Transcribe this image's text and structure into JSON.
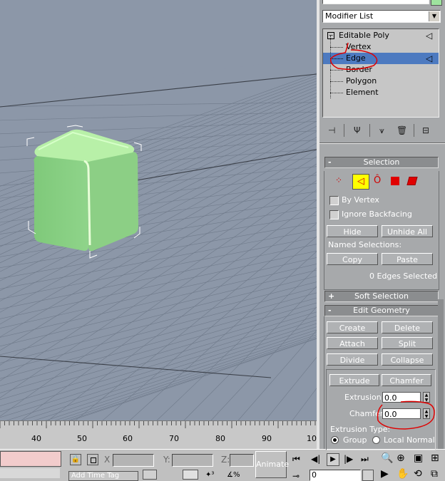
{
  "modifier_list": {
    "label": "Modifier List"
  },
  "stack": {
    "items": [
      {
        "label": "Editable Poly",
        "indent": 0
      },
      {
        "label": "Vertex",
        "indent": 1
      },
      {
        "label": "Edge",
        "indent": 1,
        "selected": true
      },
      {
        "label": "Border",
        "indent": 1
      },
      {
        "label": "Polygon",
        "indent": 1
      },
      {
        "label": "Element",
        "indent": 1
      }
    ]
  },
  "selection": {
    "title": "Selection",
    "collapse_sign": "-",
    "by_vertex": "By Vertex",
    "ignore_backfacing": "Ignore Backfacing",
    "hide": "Hide",
    "unhide_all": "Unhide All",
    "named_selections": "Named Selections:",
    "copy": "Copy",
    "paste": "Paste",
    "status": "0 Edges Selected"
  },
  "soft_selection": {
    "title": "Soft Selection",
    "expand_sign": "+"
  },
  "edit_geometry": {
    "title": "Edit Geometry",
    "collapse_sign": "-",
    "create": "Create",
    "delete": "Delete",
    "attach": "Attach",
    "split": "Split",
    "divide": "Divide",
    "collapse": "Collapse",
    "extrude": "Extrude",
    "chamfer": "Chamfer",
    "extrusion_label": "Extrusion:",
    "extrusion_value": "0.0",
    "chamfer_label": "Chamfer",
    "chamfer_value": "0.0",
    "extrusion_type": "Extrusion Type:",
    "group": "Group",
    "local_normal": "Local Normal"
  },
  "timeline": {
    "ticks": [
      "40",
      "50",
      "60",
      "70",
      "80",
      "90",
      "10"
    ]
  },
  "status_bar": {
    "x_label": "X",
    "y_label": "Y:",
    "z_label": "Z:",
    "animate": "Animate",
    "add_time_tag": "Add Time Tag",
    "frame": "0"
  },
  "colors": {
    "viewport": "#8c97a8",
    "cube": "#8fd48a",
    "highlight": "#4d7ac0",
    "panel": "#a7a9ab",
    "annotation": "#e00000"
  }
}
